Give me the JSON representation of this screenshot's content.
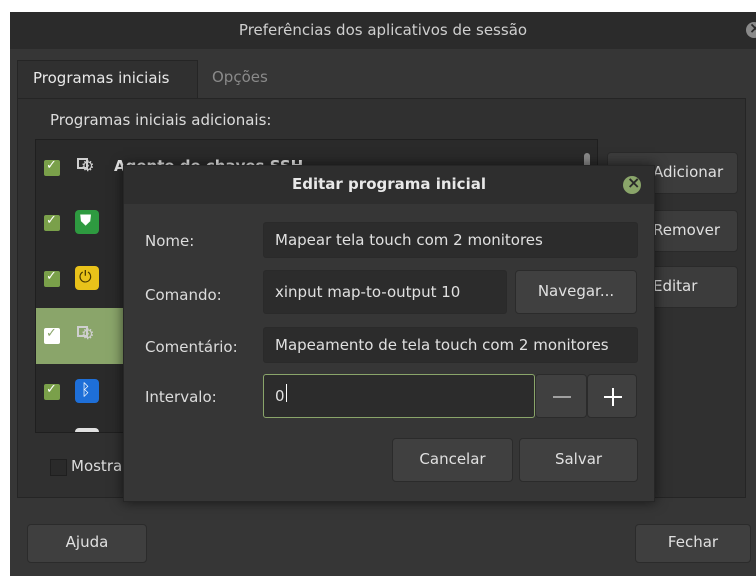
{
  "window": {
    "title": "Preferências dos aplicativos de sessão"
  },
  "tabs": [
    {
      "label": "Programas iniciais"
    },
    {
      "label": "Opções"
    }
  ],
  "startup": {
    "section_label": "Programas iniciais adicionais:",
    "items": [
      {
        "label": "Agente de chaves SSH",
        "icon": "gear-icon",
        "checked": true
      },
      {
        "label": "",
        "icon": "shield-icon",
        "checked": true
      },
      {
        "label": "",
        "icon": "power-icon",
        "checked": true
      },
      {
        "label": "",
        "icon": "gear-icon",
        "checked": true,
        "selected": true
      },
      {
        "label": "",
        "icon": "bluetooth-icon",
        "checked": true
      },
      {
        "label": "",
        "icon": "app-icon",
        "checked": true
      }
    ],
    "buttons": {
      "add": "Adicionar",
      "remove": "Remover",
      "edit": "Editar"
    },
    "show_hidden_label": "Mostrar"
  },
  "footer": {
    "help": "Ajuda",
    "close": "Fechar"
  },
  "dialog": {
    "title": "Editar programa inicial",
    "name_label": "Nome:",
    "name_value": "Mapear tela touch com 2 monitores",
    "command_label": "Comando:",
    "command_value": "xinput map-to-output 10",
    "browse": "Navegar...",
    "comment_label": "Comentário:",
    "comment_value": "Mapeamento de tela touch com 2 monitores",
    "delay_label": "Intervalo:",
    "delay_value": "0",
    "cancel": "Cancelar",
    "save": "Salvar"
  },
  "colors": {
    "accent": "#8aa56a",
    "background": "#363636",
    "titlebar": "#2b2b2b"
  }
}
